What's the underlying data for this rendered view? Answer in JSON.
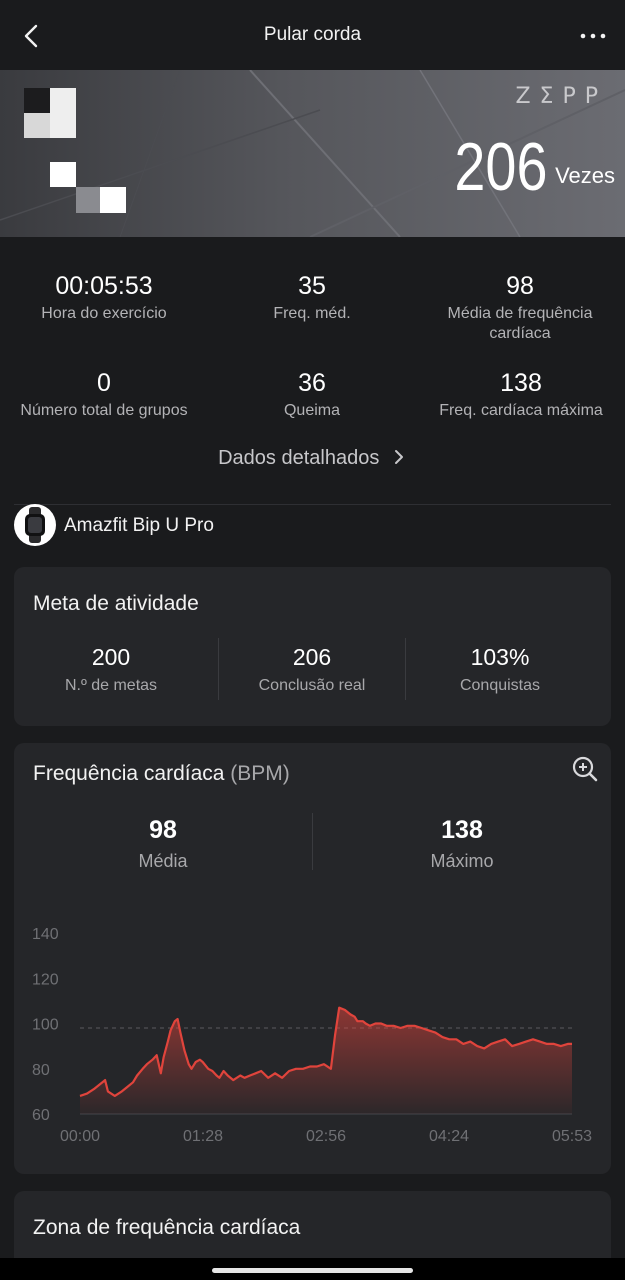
{
  "header": {
    "title": "Pular corda",
    "back_icon": "chevron-left-icon",
    "more_icon": "more-horizontal-icon"
  },
  "banner": {
    "brand": "ZΣPP",
    "count": "206",
    "unit": "Vezes"
  },
  "stats": [
    {
      "value": "00:05:53",
      "label": "Hora do exercício"
    },
    {
      "value": "35",
      "label": "Freq. méd."
    },
    {
      "value": "98",
      "label": "Média de frequência cardíaca"
    },
    {
      "value": "0",
      "label": "Número total de grupos"
    },
    {
      "value": "36",
      "label": "Queima"
    },
    {
      "value": "138",
      "label": "Freq. cardíaca máxima"
    }
  ],
  "details_link": "Dados detalhados",
  "device": {
    "name": "Amazfit Bip U Pro",
    "icon": "watch-icon"
  },
  "goal_card": {
    "title": "Meta de atividade",
    "items": [
      {
        "value": "200",
        "label": "N.º de metas"
      },
      {
        "value": "206",
        "label": "Conclusão real"
      },
      {
        "value": "103%",
        "label": "Conquistas"
      }
    ]
  },
  "hr_card": {
    "title": "Frequência cardíaca",
    "unit": "(BPM)",
    "zoom_icon": "zoom-in-icon",
    "avg_value": "98",
    "avg_label": "Média",
    "max_value": "138",
    "max_label": "Máximo"
  },
  "zone_card": {
    "title": "Zona de frequência cardíaca"
  },
  "colors": {
    "line": "#e0443c",
    "background": "#1a1b1d",
    "card": "#252629"
  },
  "chart_data": {
    "type": "area",
    "title": "",
    "xlabel": "",
    "ylabel": "",
    "x_ticks": [
      "00:00",
      "01:28",
      "02:56",
      "04:24",
      "05:53"
    ],
    "y_ticks": [
      60,
      80,
      100,
      120,
      140
    ],
    "ylim": [
      60,
      140
    ],
    "xlim": [
      0,
      353
    ],
    "reference_line": 98,
    "series": [
      {
        "x": [
          0,
          5,
          10,
          14,
          18,
          20,
          25,
          30,
          34,
          38,
          41,
          45,
          48,
          52,
          55,
          58,
          60,
          63,
          65,
          68,
          70,
          72,
          75,
          78,
          80,
          83,
          86,
          88,
          92,
          95,
          98,
          100,
          103,
          106,
          110,
          115,
          118,
          122,
          126,
          130,
          135,
          140,
          145,
          150,
          155,
          160,
          165,
          170,
          175,
          180,
          183,
          186,
          190,
          194,
          197,
          199,
          201,
          203,
          205,
          208,
          212,
          216,
          220,
          225,
          230,
          235,
          240,
          245,
          250,
          255,
          260,
          265,
          270,
          275,
          280,
          285,
          290,
          295,
          300,
          305,
          310,
          315,
          320,
          325,
          330,
          335,
          340,
          345,
          350,
          353
        ],
        "y": [
          68,
          69,
          71,
          73,
          75,
          70,
          68,
          70,
          72,
          74,
          77,
          80,
          82,
          84,
          86,
          78,
          85,
          92,
          97,
          101,
          102,
          96,
          88,
          82,
          80,
          83,
          84,
          83,
          80,
          79,
          77,
          76,
          79,
          77,
          75,
          77,
          76,
          77,
          78,
          79,
          76,
          78,
          76,
          79,
          80,
          80,
          81,
          81,
          82,
          80,
          95,
          107,
          106,
          104,
          103,
          101,
          101,
          101,
          100,
          99,
          100,
          100,
          99,
          99,
          98,
          99,
          99,
          98,
          97,
          96,
          94,
          93,
          93,
          91,
          92,
          90,
          89,
          91,
          92,
          93,
          90,
          91,
          92,
          93,
          92,
          91,
          91,
          90,
          91,
          91
        ]
      }
    ]
  }
}
